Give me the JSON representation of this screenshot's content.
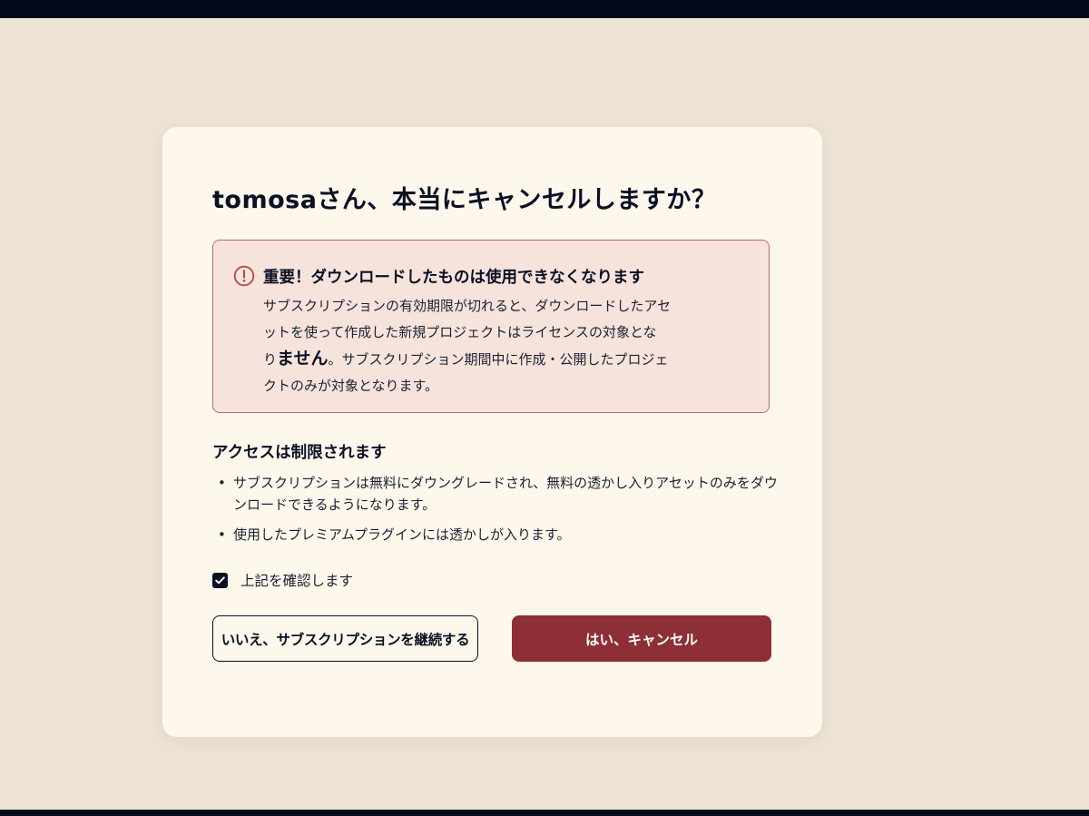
{
  "modal": {
    "title": "tomosaさん、本当にキャンセルしますか？",
    "warning": {
      "icon": "alert-circle-icon",
      "title": "重要！ダウンロードしたものは使用できなくなります",
      "body_line1": "サブスクリプションの有効期限が切れると、ダウンロードしたアセ",
      "body_line2": "ットを使って作成した新規プロジェクトはライセンスの対象とな",
      "body_line3_pre": "り",
      "body_line3_emph": "ません",
      "body_line3_post": "。サブスクリプション期間中に作成・公開したプロジェ",
      "body_line4": "クトのみが対象となります。"
    },
    "access": {
      "heading": "アクセスは制限されます",
      "items": [
        "サブスクリプションは無料にダウングレードされ、無料の透かし入りアセットのみをダウンロードできるようになります。",
        "使用したプレミアムプラグインには透かしが入ります。"
      ]
    },
    "confirm": {
      "label": "上記を確認します",
      "checked": true
    },
    "buttons": {
      "keep_label": "いいえ、サブスクリプションを継続する",
      "cancel_label": "はい、キャンセル"
    }
  },
  "colors": {
    "background": "#ede3d5",
    "modal": "#fdf7ec",
    "warning_bg": "#f6e4dc",
    "warning_border": "#c06a60",
    "primary_danger": "#8e2e36",
    "text": "#0b1024",
    "top_bar": "#050a1a"
  }
}
